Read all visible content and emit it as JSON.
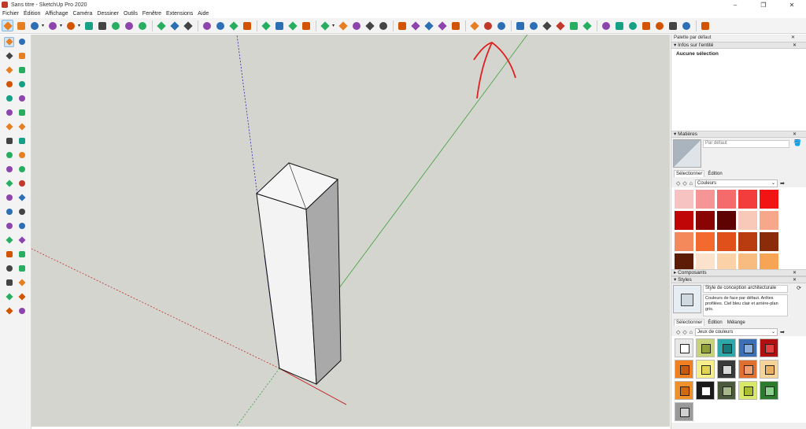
{
  "window": {
    "title": "Sans titre - SketchUp Pro 2020",
    "controls": [
      "–",
      "❐",
      "✕"
    ]
  },
  "menu": [
    "Fichier",
    "Édition",
    "Affichage",
    "Caméra",
    "Dessiner",
    "Outils",
    "Fenêtre",
    "Extensions",
    "Aide"
  ],
  "toolbar": {
    "icons": [
      "select-icon",
      "eraser-icon",
      "pencil-icon",
      "dropdown",
      "arc-icon",
      "dropdown",
      "rectangle-icon",
      "dropdown",
      "push-pull-icon",
      "move-icon",
      "rotate-icon",
      "scale-icon",
      "offset-icon",
      "tape-measure-icon",
      "text-icon",
      "paint-bucket-icon",
      "orbit-icon",
      "pan-icon",
      "zoom-icon",
      "zoom-extents-icon",
      "warehouse-icon",
      "extension-warehouse-icon",
      "share-model-icon",
      "send-to-layout-icon",
      "user-icon",
      "dropdown",
      "section-plane-icon",
      "section-display-icon",
      "section-cuts-icon",
      "solid-tools-icon",
      "sandbox-icon",
      "arrows-icon",
      "flip-icon",
      "select-axis-icon",
      "intersect-icon",
      "undo-icon",
      "redo-icon",
      "print-icon",
      "iso-view-icon",
      "top-view-icon",
      "front-view-icon",
      "right-view-icon",
      "back-view-icon",
      "left-view-icon",
      "xray-icon",
      "back-edges-icon",
      "wireframe-icon",
      "hidden-line-icon",
      "shaded-icon",
      "textured-icon",
      "monochrome-icon",
      "scenes-icon"
    ],
    "active_index": 0
  },
  "left_toolbar": [
    [
      "select-icon",
      "component-icon"
    ],
    [
      "paint-bucket-icon",
      "eraser-icon"
    ],
    [
      "line-icon",
      "freehand-icon"
    ],
    [
      "rectangle-icon",
      "rotated-rect-icon"
    ],
    [
      "circle-icon",
      "polygon-icon"
    ],
    [
      "arc-icon",
      "2pt-arc-icon"
    ],
    [
      "3pt-arc-icon",
      "pie-icon"
    ],
    [
      "move-icon",
      "push-pull-icon"
    ],
    [
      "rotate-icon",
      "follow-me-icon"
    ],
    [
      "scale-icon",
      "offset-icon"
    ],
    [
      "tape-measure-icon",
      "dimension-icon"
    ],
    [
      "protractor-icon",
      "text-icon"
    ],
    [
      "axes-icon",
      "3d-text-icon"
    ],
    [
      "orbit-icon",
      "pan-icon"
    ],
    [
      "zoom-icon",
      "zoom-window-icon"
    ],
    [
      "zoom-extents-icon",
      "previous-view-icon"
    ],
    [
      "position-camera-icon",
      "look-around-icon"
    ],
    [
      "walk-icon",
      "section-plane-icon"
    ],
    [
      "warehouse-icon",
      "extension-icon"
    ],
    [
      "share-icon",
      "layout-icon"
    ]
  ],
  "panel": {
    "title": "Palette par défaut",
    "entity_info": {
      "header": "Infos sur l'entité",
      "value": "Aucune sélection"
    },
    "materials": {
      "header": "Matières",
      "default_label": "Par défaut",
      "tabs": [
        "Sélectionner",
        "Édition"
      ],
      "collection": "Couleurs",
      "swatches": [
        "#f7c2c2",
        "#f59595",
        "#f56a6a",
        "#f33c3c",
        "#f21414",
        "#c00606",
        "#8a0404",
        "#5e0202",
        "#f8c8b8",
        "#f7a88a",
        "#f48a5c",
        "#f26a2e",
        "#e0501a",
        "#b83c10",
        "#8a2c0a",
        "#5c1c06",
        "#fbe2cc",
        "#fbd1a8",
        "#f9bc80",
        "#f7a455"
      ]
    },
    "components": {
      "header": "Composants"
    },
    "styles": {
      "header": "Styles",
      "name": "Style de conception architecturale",
      "description": "Couleurs de face par défaut. Arêtes profilées. Ciel bleu clair et arrière-plan gris.",
      "tabs": [
        "Sélectionner",
        "Édition",
        "Mélange"
      ],
      "collection": "Jeux de couleurs",
      "thumbs": [
        {
          "bg": "#e8e8e8",
          "fg": "#ffffff"
        },
        {
          "bg": "#c7d27a",
          "fg": "#8fa03a"
        },
        {
          "bg": "#2ea8a8",
          "fg": "#157a7a"
        },
        {
          "bg": "#3c6fb4",
          "fg": "#8ab0e0"
        },
        {
          "bg": "#b01010",
          "fg": "#e04040"
        },
        {
          "bg": "#f08020",
          "fg": "#c85a10"
        },
        {
          "bg": "#f6ef8a",
          "fg": "#e0d450"
        },
        {
          "bg": "#3a3a3a",
          "fg": "#d8d8d8"
        },
        {
          "bg": "#e07030",
          "fg": "#f0a070"
        },
        {
          "bg": "#f5d49a",
          "fg": "#e8b060"
        },
        {
          "bg": "#f0902a",
          "fg": "#d06a10"
        },
        {
          "bg": "#1a1a1a",
          "fg": "#ffffff"
        },
        {
          "bg": "#4a5a3a",
          "fg": "#a8b888"
        },
        {
          "bg": "#d8e86a",
          "fg": "#a8c030"
        },
        {
          "bg": "#2c7a2c",
          "fg": "#8ad08a"
        },
        {
          "bg": "#9a9a9a",
          "fg": "#d0d0d0"
        }
      ]
    }
  },
  "colors": {
    "viewport_bg": "#d5d5d0",
    "axis_red": "#c0302a",
    "axis_green": "#3aa03a",
    "axis_blue": "#2a2ab0",
    "annotation": "#e02020"
  }
}
